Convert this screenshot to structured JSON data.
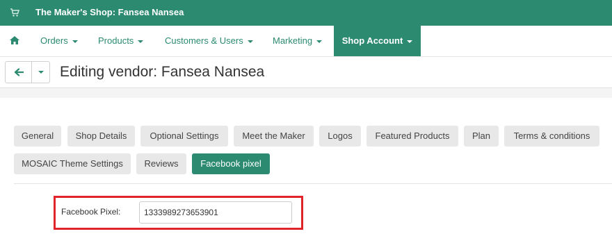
{
  "topbar": {
    "shop_title": "The Maker's Shop: Fansea Nansea"
  },
  "nav": {
    "items": [
      {
        "label": "Orders"
      },
      {
        "label": "Products"
      },
      {
        "label": "Customers & Users"
      },
      {
        "label": "Marketing"
      },
      {
        "label": "Shop Account"
      }
    ]
  },
  "header": {
    "title": "Editing vendor: Fansea Nansea"
  },
  "tabs": [
    {
      "label": "General"
    },
    {
      "label": "Shop Details"
    },
    {
      "label": "Optional Settings"
    },
    {
      "label": "Meet the Maker"
    },
    {
      "label": "Logos"
    },
    {
      "label": "Featured Products"
    },
    {
      "label": "Plan"
    },
    {
      "label": "Terms & conditions"
    },
    {
      "label": "MOSAIC Theme Settings"
    },
    {
      "label": "Reviews"
    },
    {
      "label": "Facebook pixel"
    }
  ],
  "form": {
    "facebook_pixel_label": "Facebook Pixel:",
    "facebook_pixel_value": "1333989273653901"
  },
  "colors": {
    "brand": "#2b8a70",
    "highlight": "#e0242a"
  },
  "icons": {
    "cart": "shopping-cart-icon",
    "home": "home-icon",
    "back": "arrow-left-icon"
  }
}
